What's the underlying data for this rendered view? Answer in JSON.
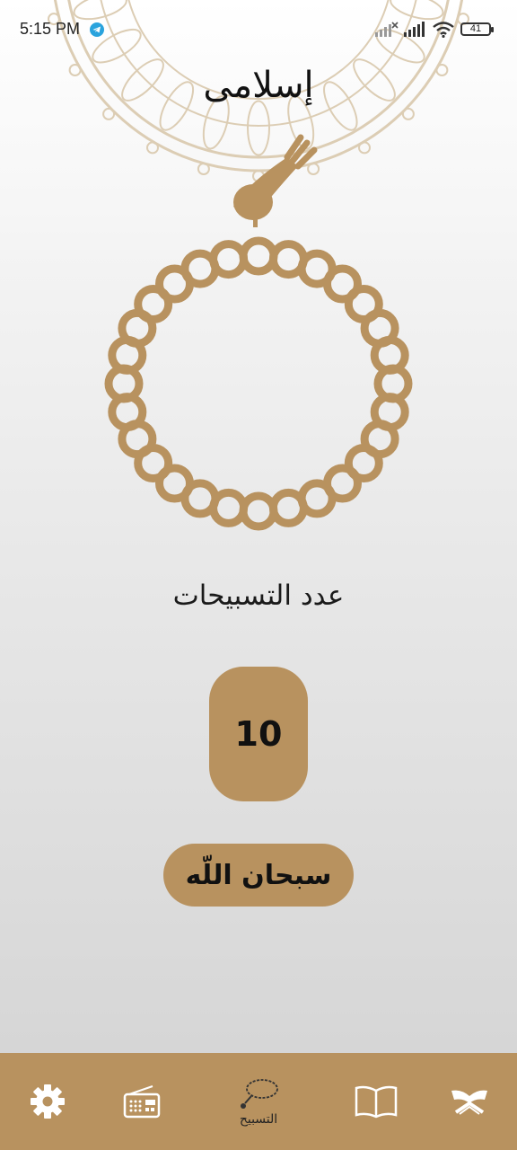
{
  "status_bar": {
    "time": "5:15 PM",
    "battery": "41"
  },
  "header": {
    "app_title": "إسلامى"
  },
  "main": {
    "count_label": "عدد التسبيحات",
    "count_value": "10",
    "dhikr_button_label": "سبحان اللّه"
  },
  "bottom_nav": {
    "items": [
      {
        "icon": "settings-gear-icon"
      },
      {
        "icon": "radio-icon"
      },
      {
        "icon": "tasbih-icon",
        "label": "التسبيح",
        "active": true
      },
      {
        "icon": "book-icon"
      },
      {
        "icon": "quran-stand-icon"
      }
    ]
  },
  "colors": {
    "accent": "#b8925f",
    "ornament": "#dccdb4"
  }
}
